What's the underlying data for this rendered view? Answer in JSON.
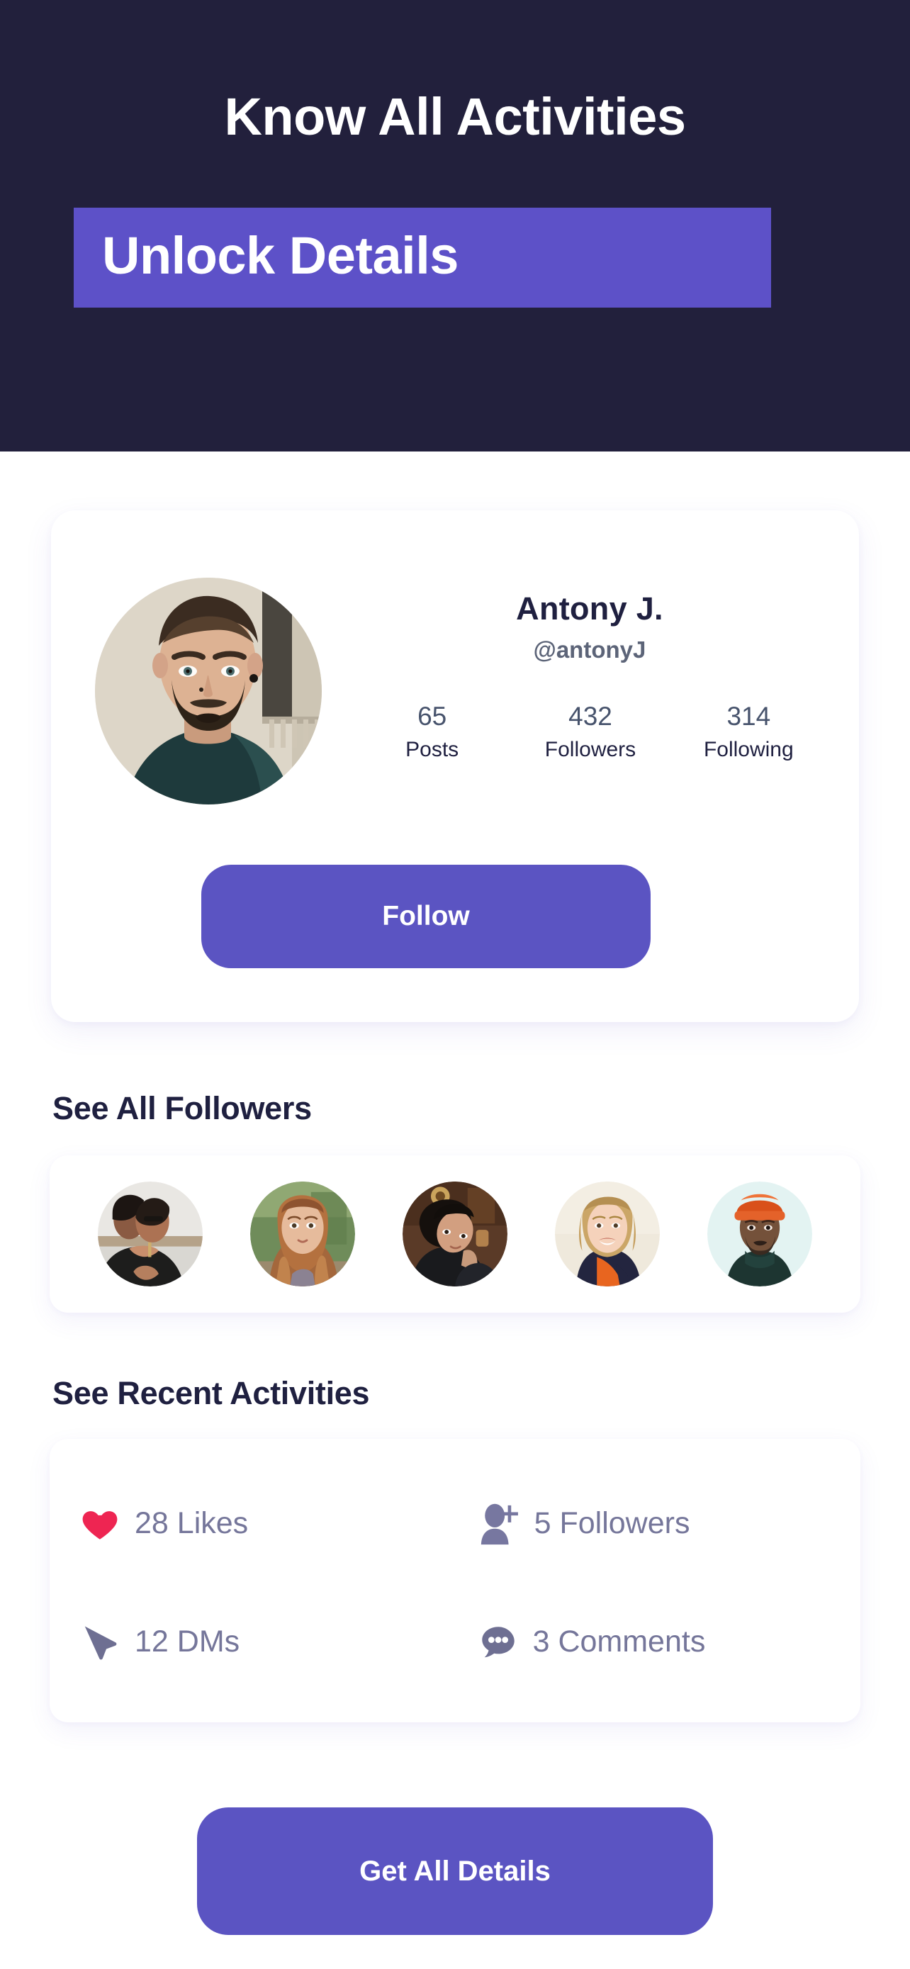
{
  "hero": {
    "title": "Know All Activities",
    "subtitle": "Unlock Details",
    "bg_color": "#22203C",
    "highlight_color": "#5D51C8",
    "text_color": "#FFFFFF"
  },
  "profile": {
    "name": "Antony J.",
    "handle": "@antonyJ",
    "avatar_icon": "user-photo-avatar",
    "stats": [
      {
        "value": "65",
        "label": "Posts"
      },
      {
        "value": "432",
        "label": "Followers"
      },
      {
        "value": "314",
        "label": "Following"
      }
    ],
    "follow_label": "Follow",
    "accent_color": "#5B54C2"
  },
  "followers_section": {
    "heading": "See All Followers",
    "avatars": [
      {
        "icon": "follower-photo-avatar-1",
        "bg": "#e8e6e2",
        "skin": "#b2795e",
        "hair": "#241c18",
        "shirt": "#20201f"
      },
      {
        "icon": "follower-photo-avatar-2",
        "bg": "#7e9464",
        "skin": "#e0b292",
        "hair": "#a8683f",
        "shirt": "#8b8292"
      },
      {
        "icon": "follower-photo-avatar-3",
        "bg": "#60402c",
        "skin": "#d4a285",
        "hair": "#18120f",
        "shirt": "#191a1d"
      },
      {
        "icon": "follower-photo-avatar-4",
        "bg": "#efe9dc",
        "skin": "#f0cdb4",
        "hair": "#c9a36a",
        "shirt": "#20223f"
      },
      {
        "icon": "follower-photo-avatar-5",
        "bg": "#e2f2f1",
        "skin": "#6e4a34",
        "hair": "#d94f18",
        "shirt": "#1d3531"
      }
    ]
  },
  "activities_section": {
    "heading": "See Recent Activities",
    "items": [
      {
        "icon": "heart-icon",
        "text": "28 Likes",
        "icon_color": "#EE2552"
      },
      {
        "icon": "person-add-icon",
        "text": "5 Followers",
        "icon_color": "#7777A0"
      },
      {
        "icon": "send-icon",
        "text": "12 DMs",
        "icon_color": "#6E6F92"
      },
      {
        "icon": "comment-icon",
        "text": "3 Comments",
        "icon_color": "#6E6F92"
      }
    ],
    "text_color": "#75769A"
  },
  "cta": {
    "label": "Get All Details",
    "color": "#5B54C2"
  }
}
